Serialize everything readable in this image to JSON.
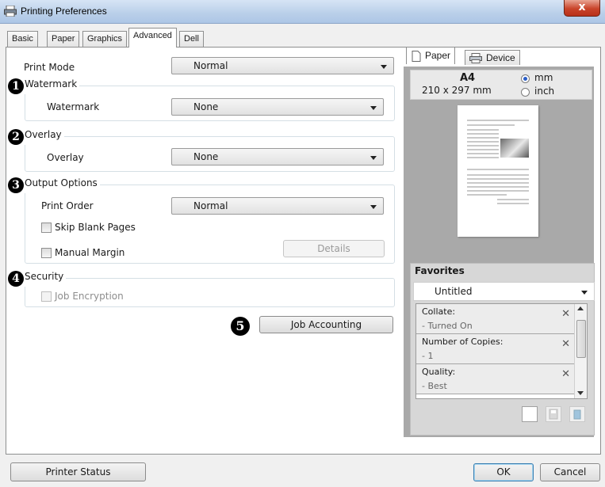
{
  "window": {
    "title": "Printing Preferences",
    "close_glyph": "x"
  },
  "tabs": [
    "Basic",
    "Paper",
    "Graphics",
    "Advanced",
    "Dell"
  ],
  "active_tab": "Advanced",
  "print_mode": {
    "label": "Print Mode",
    "value": "Normal"
  },
  "watermark": {
    "badge": "1",
    "group_title": "Watermark",
    "label": "Watermark",
    "value": "None"
  },
  "overlay": {
    "badge": "2",
    "group_title": "Overlay",
    "label": "Overlay",
    "value": "None"
  },
  "output_options": {
    "badge": "3",
    "group_title": "Output Options",
    "print_order_label": "Print Order",
    "print_order_value": "Normal",
    "skip_blank_pages": "Skip Blank Pages",
    "manual_margin": "Manual Margin",
    "details_button": "Details"
  },
  "security": {
    "badge": "4",
    "group_title": "Security",
    "job_encryption": "Job Encryption"
  },
  "job_accounting": {
    "badge": "5",
    "button": "Job Accounting"
  },
  "preview": {
    "tab_paper": "Paper",
    "tab_device": "Device",
    "size_name": "A4",
    "size_dims": "210 x 297 mm",
    "unit_mm": "mm",
    "unit_inch": "inch",
    "selected_unit": "mm"
  },
  "favorites": {
    "title": "Favorites",
    "selected": "Untitled",
    "items": [
      {
        "name": "Collate:",
        "value": "- Turned On"
      },
      {
        "name": "Number of Copies:",
        "value": "- 1"
      },
      {
        "name": "Quality:",
        "value": "- Best"
      }
    ]
  },
  "footer": {
    "printer_status": "Printer Status",
    "ok": "OK",
    "cancel": "Cancel"
  },
  "colors": {
    "title_bar": "#b9cfe9",
    "close_button": "#c9442a",
    "preview_bg": "#a9a9a9",
    "radio_accent": "#2a5dc7"
  }
}
